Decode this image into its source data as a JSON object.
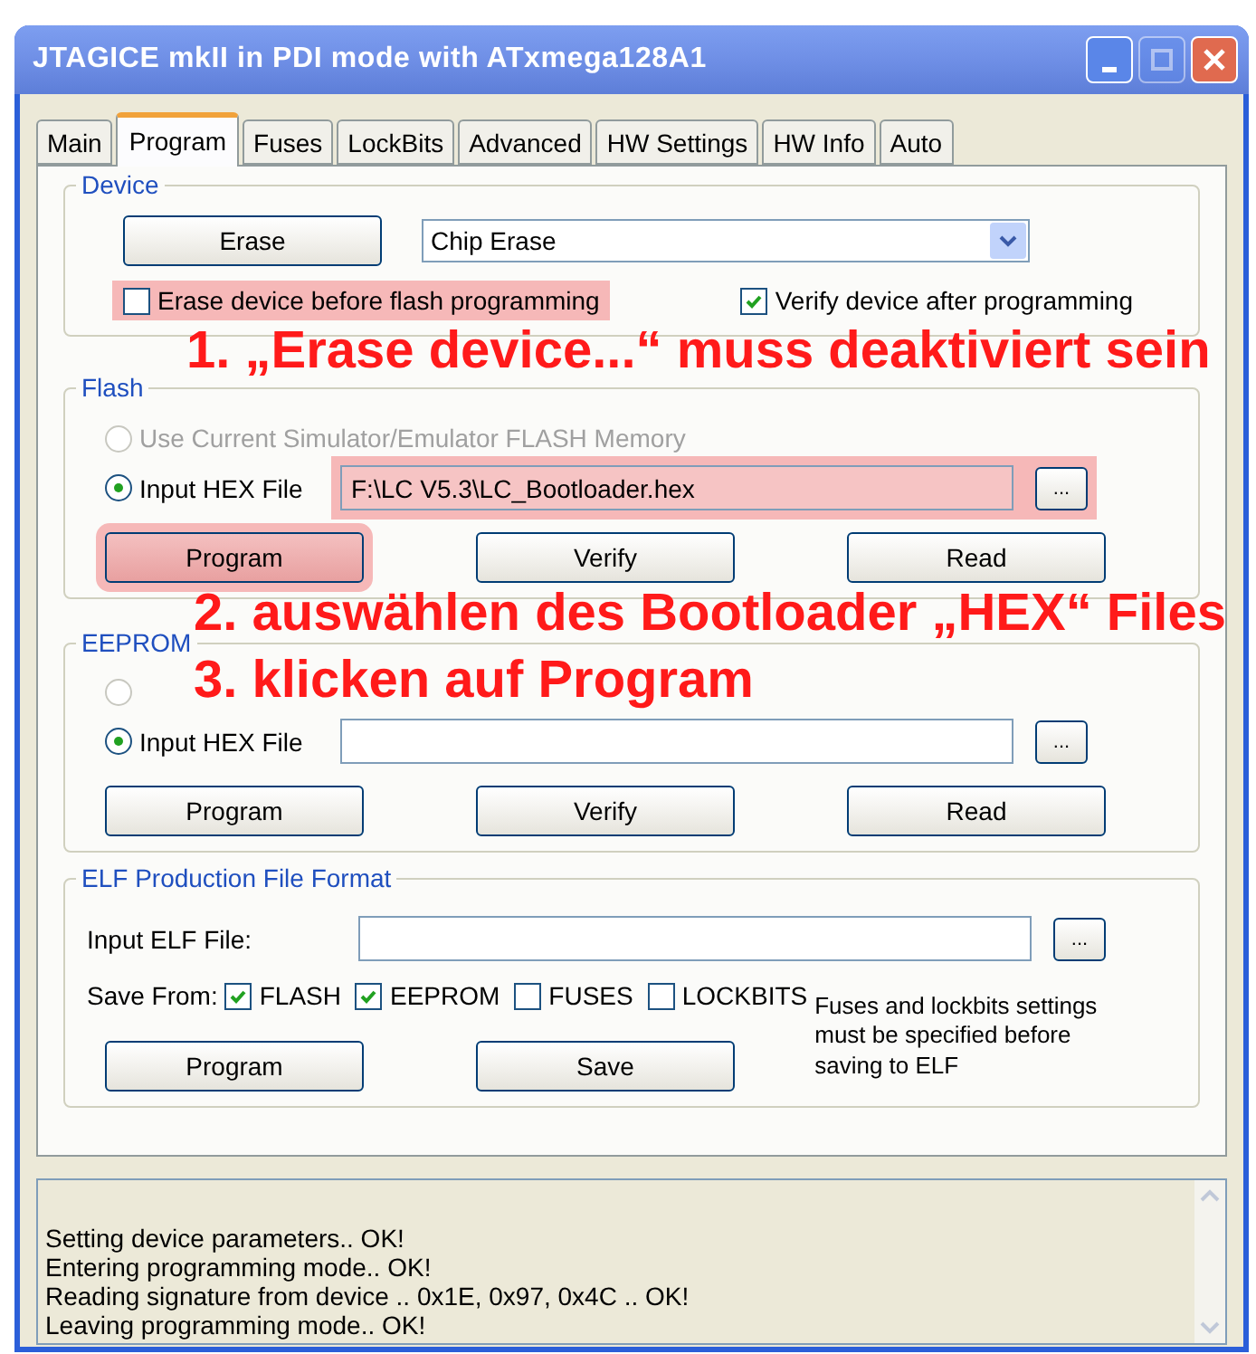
{
  "window": {
    "title": "JTAGICE mkII in PDI mode with ATxmega128A1",
    "maximize_disabled": true
  },
  "tabs": [
    {
      "label": "Main",
      "selected": false
    },
    {
      "label": "Program",
      "selected": true
    },
    {
      "label": "Fuses",
      "selected": false
    },
    {
      "label": "LockBits",
      "selected": false
    },
    {
      "label": "Advanced",
      "selected": false
    },
    {
      "label": "HW Settings",
      "selected": false
    },
    {
      "label": "HW Info",
      "selected": false
    },
    {
      "label": "Auto",
      "selected": false
    }
  ],
  "device": {
    "title": "Device",
    "erase_button": "Erase",
    "mode_select": {
      "value": "Chip Erase"
    },
    "options": [
      {
        "label": "Erase device before flash programming",
        "checked": false,
        "highlighted": true
      },
      {
        "label": "Verify device after programming",
        "checked": true,
        "highlighted": false
      }
    ]
  },
  "flash": {
    "title": "Flash",
    "sources": [
      {
        "label": "Use Current Simulator/Emulator FLASH Memory",
        "selected": false,
        "disabled": true
      },
      {
        "label": "Input HEX File",
        "selected": true,
        "disabled": false
      }
    ],
    "file": {
      "value": "F:\\LC V5.3\\LC_Bootloader.hex",
      "highlighted": true
    },
    "browse": "...",
    "buttons": [
      {
        "label": "Program",
        "highlighted": true
      },
      {
        "label": "Verify",
        "highlighted": false
      },
      {
        "label": "Read",
        "highlighted": false
      }
    ]
  },
  "eeprom": {
    "title": "EEPROM",
    "sources": [
      {
        "selected": false,
        "disabled": true
      },
      {
        "label": "Input HEX File",
        "selected": true,
        "disabled": false
      }
    ],
    "file": {
      "highlighted": false
    },
    "browse": "...",
    "buttons": [
      {
        "label": "Program",
        "highlighted": false
      },
      {
        "label": "Verify",
        "highlighted": false
      },
      {
        "label": "Read",
        "highlighted": false
      }
    ]
  },
  "elf": {
    "title": "ELF Production File Format",
    "input_label": "Input ELF File:",
    "browse": "...",
    "save_from_label": "Save From:",
    "memories": [
      {
        "label": "FLASH",
        "checked": true
      },
      {
        "label": "EEPROM",
        "checked": true
      },
      {
        "label": "FUSES",
        "checked": false
      },
      {
        "label": "LOCKBITS",
        "checked": false
      }
    ],
    "note": "Fuses and lockbits settings must be specified before saving to ELF",
    "buttons": [
      "Program",
      "Save"
    ]
  },
  "log": {
    "lines": [
      "Setting device parameters.. OK!",
      "Entering programming mode.. OK!",
      "Reading signature from device .. 0x1E, 0x97, 0x4C .. OK!",
      "Leaving programming mode.. OK!"
    ]
  },
  "annotations": [
    "1. „Erase device...“ muss deaktiviert sein",
    "2. auswählen des Bootloader „HEX“ Files",
    "3. klicken auf Program"
  ]
}
